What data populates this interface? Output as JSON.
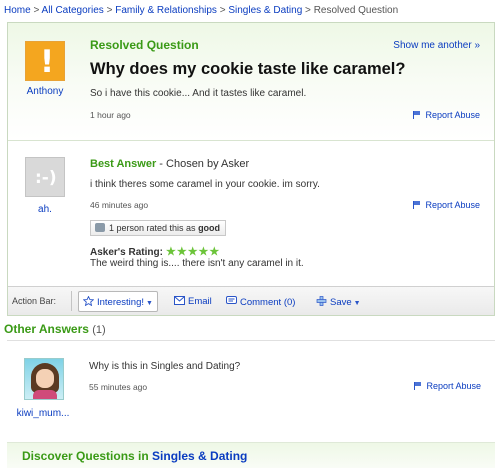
{
  "breadcrumb": {
    "items": [
      "Home",
      "All Categories",
      "Family & Relationships",
      "Singles & Dating"
    ],
    "current": "Resolved Question"
  },
  "question": {
    "status_label": "Resolved Question",
    "show_another": "Show me another »",
    "title": "Why does my cookie taste like caramel?",
    "body": "So i have this cookie... And it tastes like caramel.",
    "time": "1 hour ago",
    "report": "Report Abuse",
    "asker": "Anthony"
  },
  "best_answer": {
    "label": "Best Answer",
    "chosen_by": " - Chosen by Asker",
    "text": "i think theres some caramel in your cookie. im sorry.",
    "time": "46 minutes ago",
    "report": "Report Abuse",
    "user": "ah.",
    "rated_prefix": "1 person rated this as ",
    "rated_value": "good",
    "asker_rating_label": "Asker's Rating:",
    "asker_rating_stars": "★★★★★",
    "asker_rating": 5,
    "asker_comment": "The weird thing is.... there isn't any caramel in it."
  },
  "action_bar": {
    "label": "Action Bar:",
    "interesting": "Interesting!",
    "email": "Email",
    "comment": "Comment (0)",
    "save": "Save"
  },
  "other_answers": {
    "title": "Other Answers",
    "count": "(1)",
    "items": [
      {
        "user": "kiwi_mum...",
        "text": "Why is this in Singles and Dating?",
        "time": "55 minutes ago",
        "report": "Report Abuse"
      }
    ]
  },
  "discover": {
    "prefix": "Discover Questions in ",
    "category": "Singles & Dating"
  },
  "colors": {
    "green": "#3a9a16",
    "link": "#0a3cc0",
    "asker_avatar": "#f4a61f",
    "stars": "#6cc43a"
  },
  "icons": [
    "exclamation-avatar-icon",
    "smiley-avatar-icon",
    "flag-icon",
    "thumbs-up-icon",
    "star-icon",
    "envelope-icon",
    "comment-icon",
    "plus-icon",
    "caret-down-icon"
  ]
}
